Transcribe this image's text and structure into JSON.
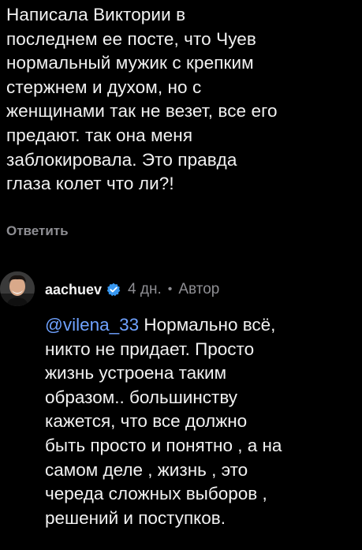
{
  "comment": {
    "text": "Написала Виктории в\nпоследнем ее посте, что Чуев\nнормальный мужик с крепким\nстержнем и духом, но с\nженщинами так не везет, все его\nпредают. так она меня\nзаблокировала. Это правда\nглаза колет что ли?!",
    "reply_label": "Ответить"
  },
  "reply": {
    "avatar_icon": "user-avatar-photo",
    "username": "aachuev",
    "verified_icon": "verified-badge-icon",
    "time": "4 дн.",
    "separator": "•",
    "author_badge": "Автор",
    "mention": "@vilena_33",
    "text_first": " Нормально всё,\nникто не придает. Просто\nжизнь устроена таким\nобразом.. большинству\nкажется, что все должно\nбыть просто и понятно , а на\nсамом деле , жизнь , это\nчереда сложных выборов ,\nрешений и поступков."
  },
  "colors": {
    "background": "#000000",
    "text": "#f2f2f2",
    "muted": "#8e8e93",
    "mention": "#6fa2ff",
    "verified": "#3797f0"
  }
}
